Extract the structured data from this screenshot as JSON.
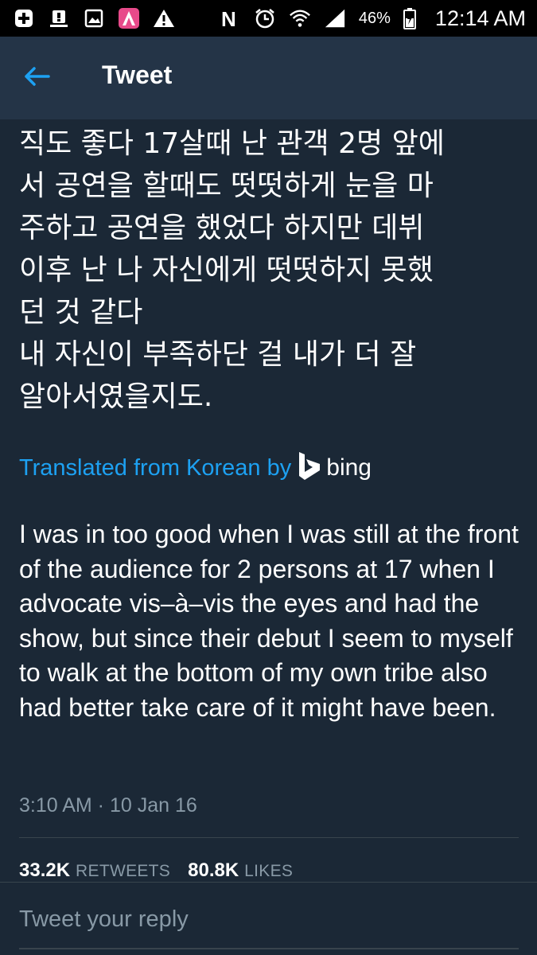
{
  "status_bar": {
    "battery_percent": "46%",
    "time": "12:14 AM",
    "left_icons": [
      "add-icon",
      "notification-icon",
      "image-icon",
      "app-icon",
      "warning-icon"
    ],
    "right_icons": [
      "nfc-icon",
      "alarm-icon",
      "wifi-icon",
      "signal-icon",
      "battery-icon"
    ]
  },
  "header": {
    "title": "Tweet",
    "accent_color": "#1da1f2"
  },
  "tweet": {
    "korean_text": "직도 좋다 17살때 난 관객 2명 앞에\n서 공연을 할때도 떳떳하게 눈을 마\n주하고 공연을 했었다 하지만 데뷔\n이후 난 나 자신에게 떳떳하지 못했\n던 것 같다\n내 자신이 부족하단 걸 내가 더 잘\n알아서였을지도.",
    "translated_label": "Translated from Korean by",
    "translator": "bing",
    "translation": "I was in too good when I was still at the front of the audience for 2 persons at 17 when I advocate vis–à–vis the eyes and had the show, but since their debut I seem to myself to walk at the bottom of my own tribe also had better take care of it might have been.",
    "timestamp": "3:10 AM · 10 Jan 16"
  },
  "stats": {
    "retweets_count": "33.2K",
    "retweets_label": "RETWEETS",
    "likes_count": "80.8K",
    "likes_label": "LIKES"
  },
  "reply": {
    "placeholder": "Tweet your reply"
  }
}
